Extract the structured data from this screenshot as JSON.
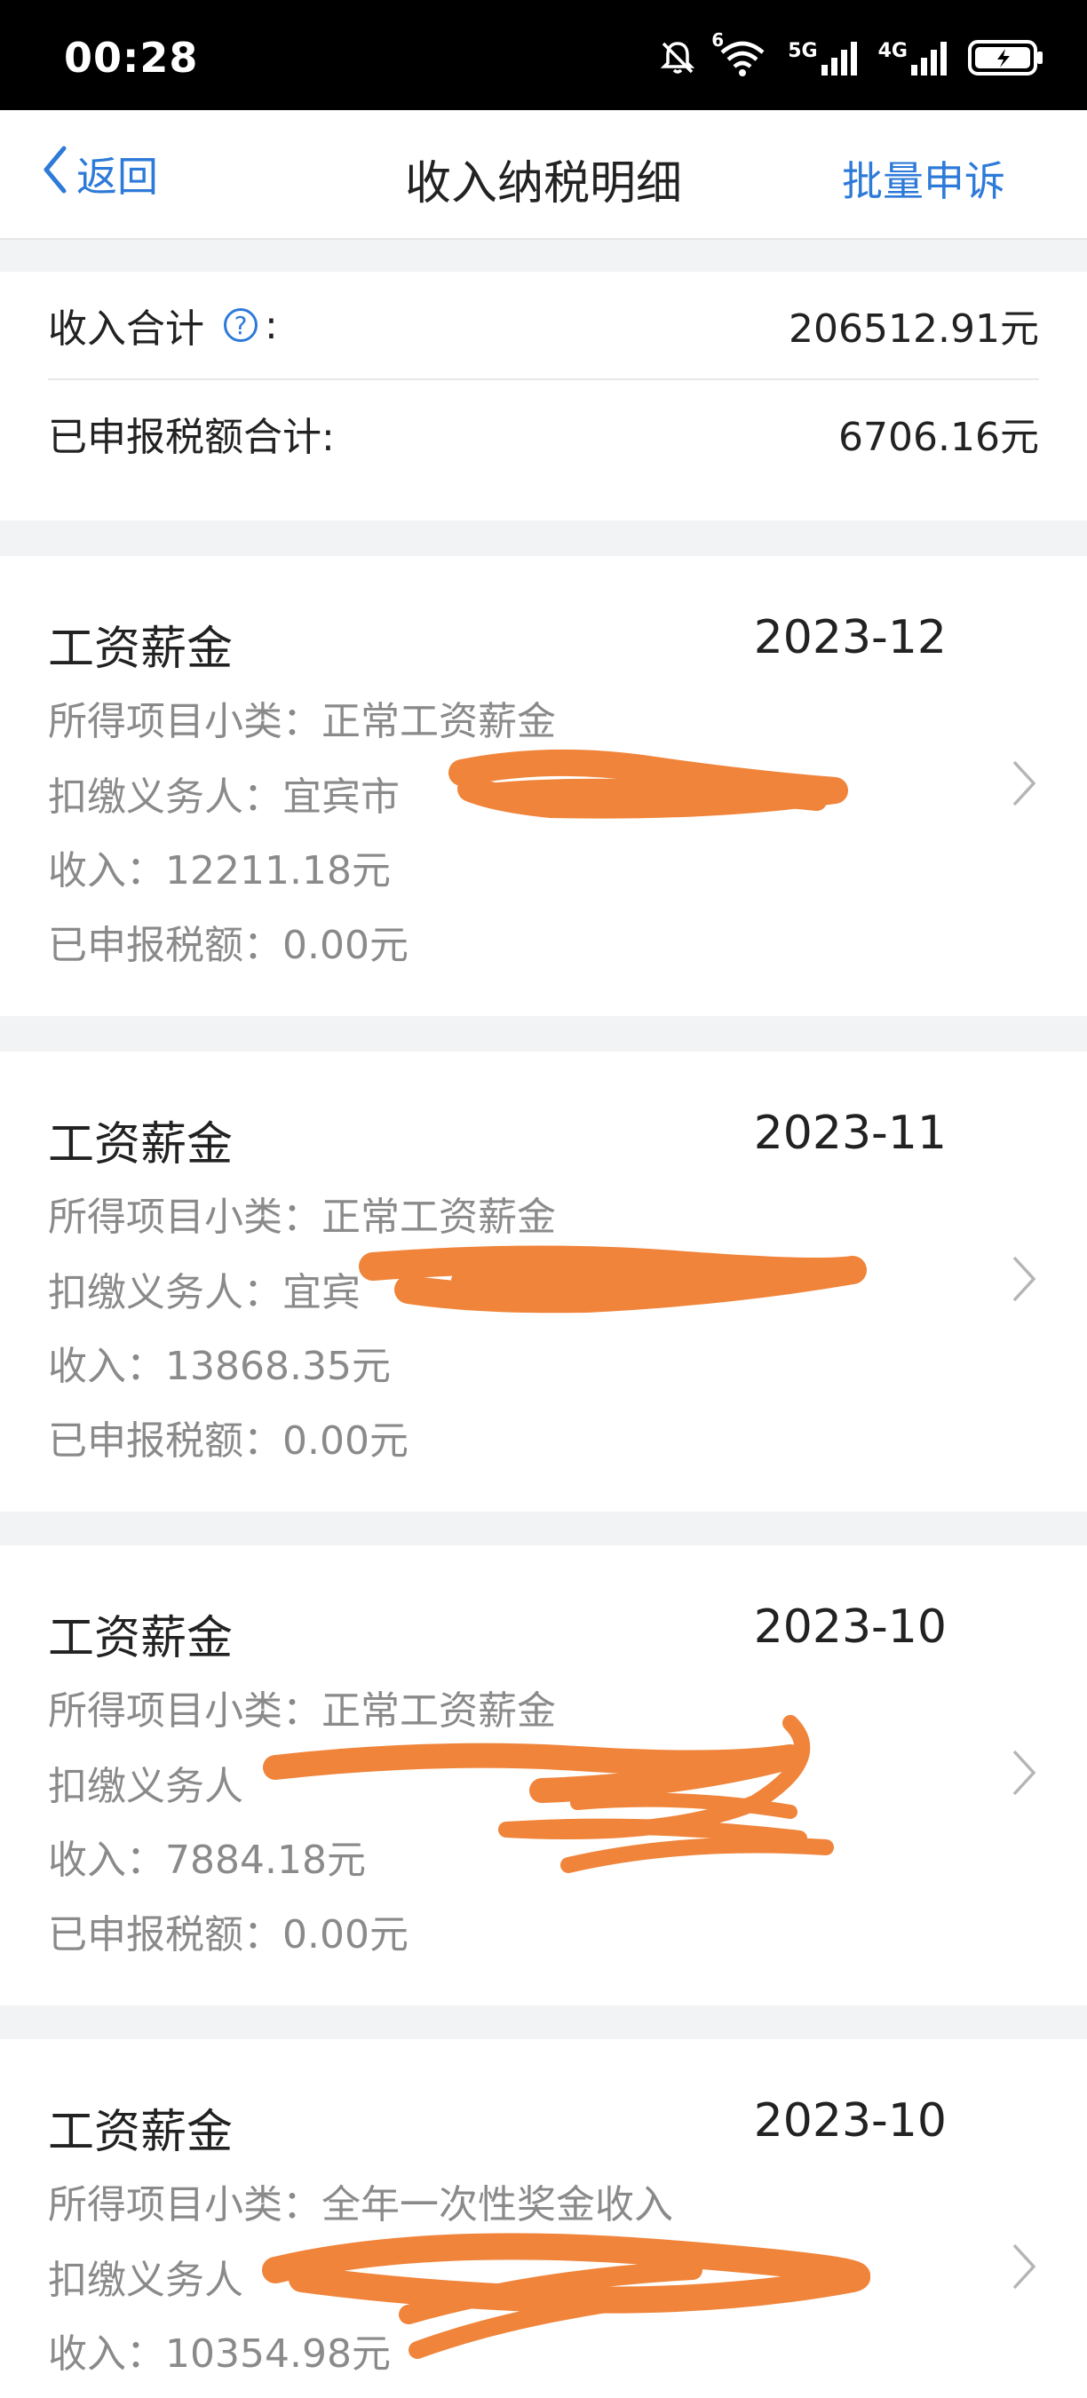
{
  "status_bar": {
    "time": "00:28",
    "icons": [
      "mute-bell-icon",
      "wifi-icon",
      "signal-5g-icon",
      "signal-4g-icon",
      "battery-charging-icon"
    ],
    "labels": {
      "wifi_badge": "6",
      "net1": "5G",
      "net2": "4G"
    }
  },
  "nav": {
    "back_label": "返回",
    "title": "收入纳税明细",
    "action_label": "批量申诉"
  },
  "summary": {
    "income_label": "收入合计",
    "income_suffix": ":",
    "income_value": "206512.91元",
    "tax_label": "已申报税额合计:",
    "tax_value": "6706.16元"
  },
  "records": [
    {
      "title": "工资薪金",
      "period": "2023-12",
      "subcategory": "所得项目小类：正常工资薪金",
      "withholder": "扣缴义务人：宜宾市",
      "income": "收入：12211.18元",
      "tax": "已申报税额：0.00元"
    },
    {
      "title": "工资薪金",
      "period": "2023-11",
      "subcategory": "所得项目小类：正常工资薪金",
      "withholder": "扣缴义务人：宜宾",
      "income": "收入：13868.35元",
      "tax": "已申报税额：0.00元"
    },
    {
      "title": "工资薪金",
      "period": "2023-10",
      "subcategory": "所得项目小类：正常工资薪金",
      "withholder": "扣缴义务人",
      "income": "收入：7884.18元",
      "tax": "已申报税额：0.00元"
    },
    {
      "title": "工资薪金",
      "period": "2023-10",
      "subcategory": "所得项目小类：全年一次性奖金收入",
      "withholder": "扣缴义务人",
      "income": "收入：10354.98元",
      "tax": ""
    }
  ],
  "colors": {
    "accent": "#2e7ad9",
    "redaction": "#f0843a",
    "muted_text": "#8a8a8a",
    "background": "#f2f3f5"
  }
}
